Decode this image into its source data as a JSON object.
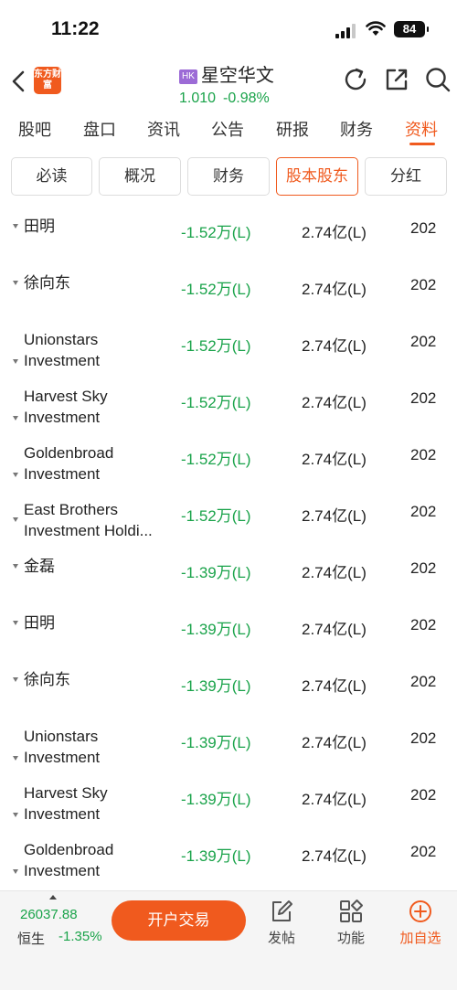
{
  "status_bar": {
    "time": "11:22",
    "battery": "84"
  },
  "header": {
    "logo_text": "东方财富",
    "market_badge": "HK",
    "stock_name": "星空华文",
    "price": "1.010",
    "change_pct": "-0.98%"
  },
  "main_tabs": [
    {
      "label": "股吧"
    },
    {
      "label": "盘口"
    },
    {
      "label": "资讯"
    },
    {
      "label": "公告"
    },
    {
      "label": "研报"
    },
    {
      "label": "财务"
    },
    {
      "label": "资料"
    }
  ],
  "main_tabs_active": "资料",
  "sub_tabs": [
    {
      "label": "必读"
    },
    {
      "label": "概况"
    },
    {
      "label": "财务"
    },
    {
      "label": "股本股东"
    },
    {
      "label": "分红"
    }
  ],
  "sub_tabs_active": "股本股东",
  "rows": [
    {
      "holder": "田明",
      "change": "-1.52万(L)",
      "amount": "2.74亿(L)",
      "date": "202"
    },
    {
      "holder": "徐向东",
      "change": "-1.52万(L)",
      "amount": "2.74亿(L)",
      "date": "202"
    },
    {
      "holder": "Unionstars Investment",
      "change": "-1.52万(L)",
      "amount": "2.74亿(L)",
      "date": "202"
    },
    {
      "holder": "Harvest Sky Investment",
      "change": "-1.52万(L)",
      "amount": "2.74亿(L)",
      "date": "202"
    },
    {
      "holder": "Goldenbroad Investment",
      "change": "-1.52万(L)",
      "amount": "2.74亿(L)",
      "date": "202"
    },
    {
      "holder": "East Brothers Investment Holdi...",
      "change": "-1.52万(L)",
      "amount": "2.74亿(L)",
      "date": "202"
    },
    {
      "holder": "金磊",
      "change": "-1.39万(L)",
      "amount": "2.74亿(L)",
      "date": "202"
    },
    {
      "holder": "田明",
      "change": "-1.39万(L)",
      "amount": "2.74亿(L)",
      "date": "202"
    },
    {
      "holder": "徐向东",
      "change": "-1.39万(L)",
      "amount": "2.74亿(L)",
      "date": "202"
    },
    {
      "holder": "Unionstars Investment",
      "change": "-1.39万(L)",
      "amount": "2.74亿(L)",
      "date": "202"
    },
    {
      "holder": "Harvest Sky Investment",
      "change": "-1.39万(L)",
      "amount": "2.74亿(L)",
      "date": "202"
    },
    {
      "holder": "Goldenbroad Investment",
      "change": "-1.39万(L)",
      "amount": "2.74亿(L)",
      "date": "202"
    }
  ],
  "bottom_bar": {
    "index_value": "26037.88",
    "index_name": "恒生",
    "index_change": "-1.35%",
    "trade_button": "开户交易",
    "post_label": "发帖",
    "func_label": "功能",
    "watch_label": "加自选"
  },
  "colors": {
    "accent": "#f05a1e",
    "down": "#1aa34a",
    "badge": "#9c6bd6"
  }
}
